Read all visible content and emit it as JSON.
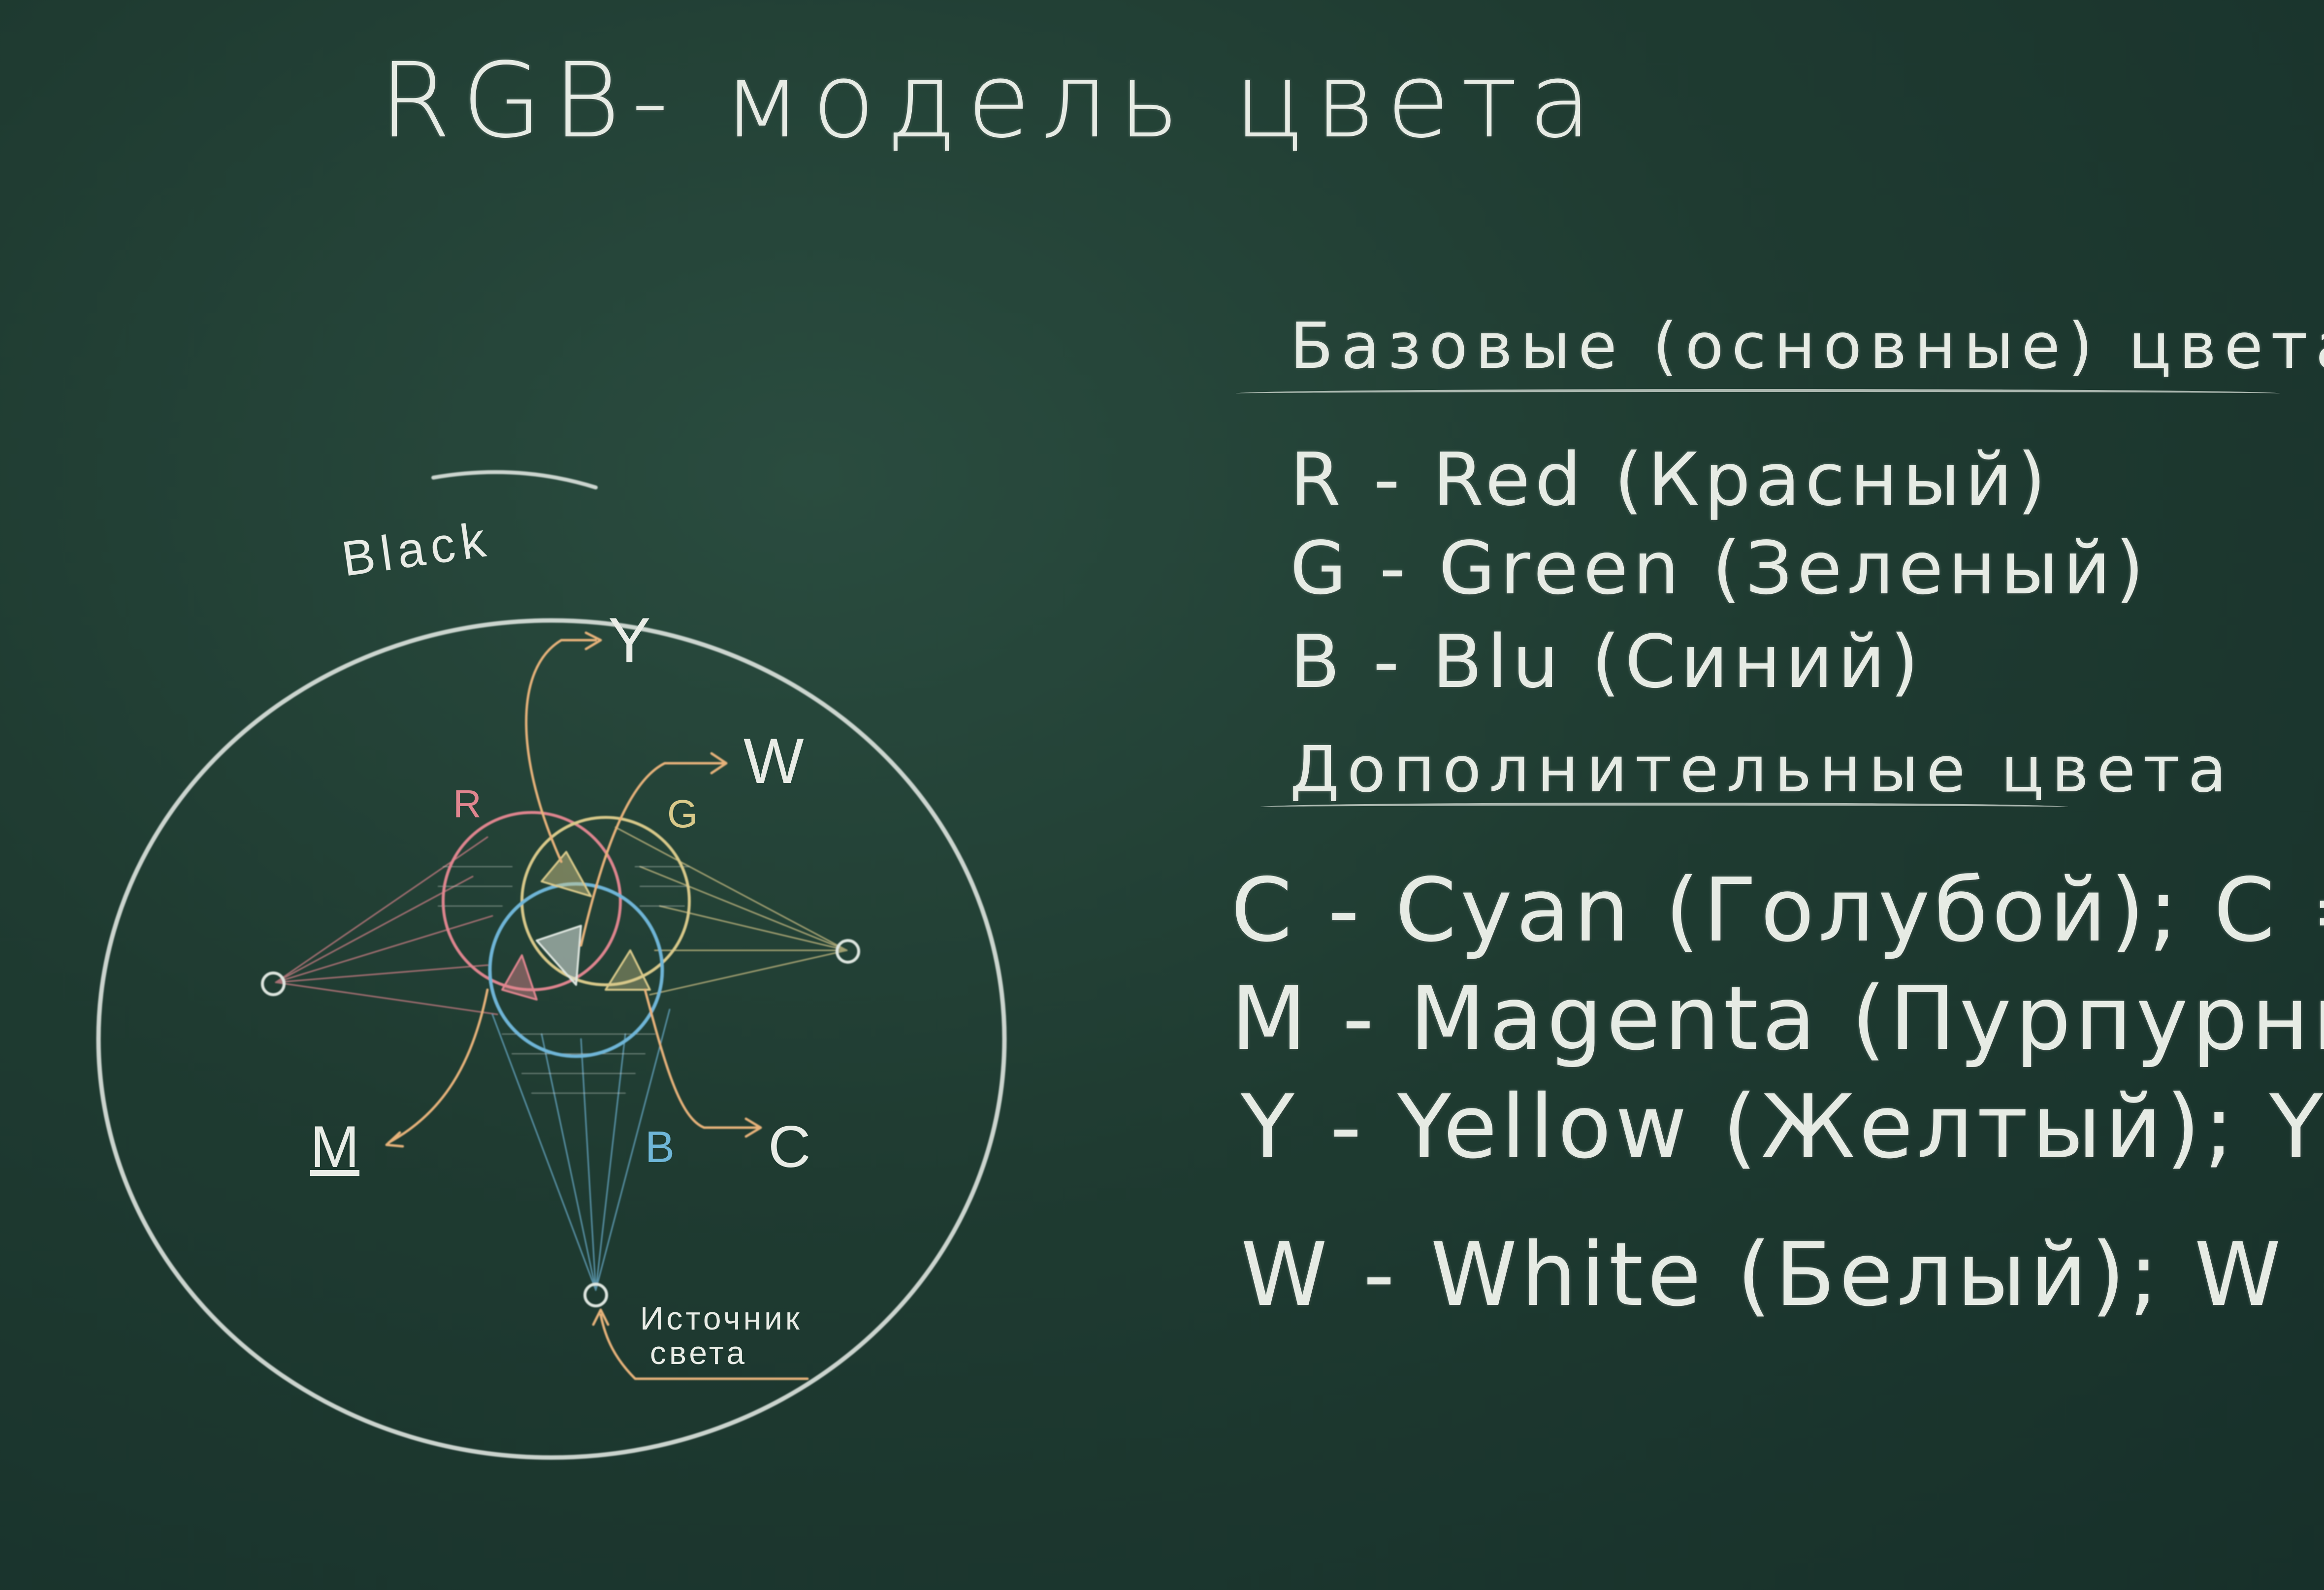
{
  "title": "RGB- модель цвета",
  "base_heading": "Базовые (основные) цвета",
  "base_colors": [
    "R - Red (Красный)",
    "G - Green (Зеленый)",
    "B - Blu (Синий)"
  ],
  "extra_heading": "Дополнительные цвета",
  "extra_colors": [
    "C - Cyan (Голубой); C = G + B",
    "M - Magenta (Пурпурный); M = R + B",
    "Y - Yellow (Желтый); Y = R + G",
    "W - White (Белый); W = R + G + B"
  ],
  "diagram": {
    "black_label": "Black",
    "label_r": "R",
    "label_g": "G",
    "label_b": "B",
    "label_y": "Y",
    "label_w": "W",
    "label_m": "M",
    "label_c": "C",
    "source_line1": "Источник",
    "source_line2": "света"
  },
  "colors": {
    "board": "#1f3b31",
    "chalk": "#e6ebe4",
    "red": "#e0858f",
    "green": "#d9c98a",
    "blue": "#6fb6d8",
    "orange": "#e7b27a"
  }
}
